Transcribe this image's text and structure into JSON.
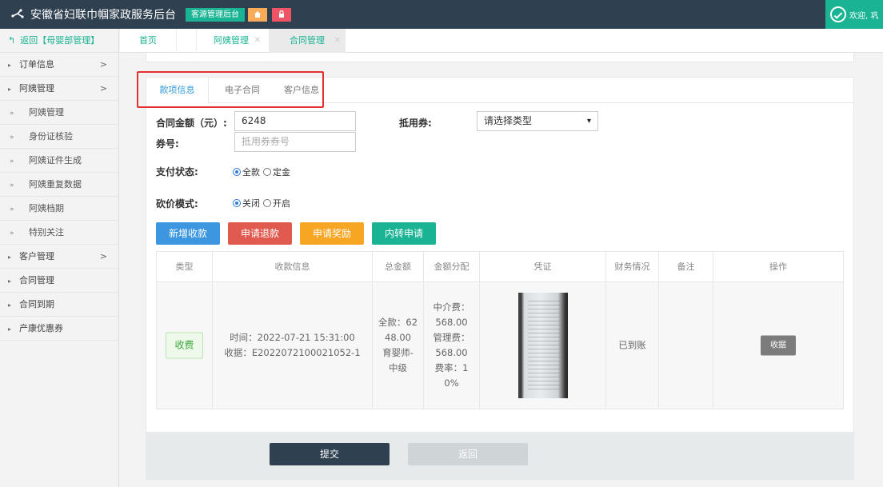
{
  "header": {
    "app_title": "安徽省妇联巾帼家政服务后台",
    "badge_source": "客源管理后台",
    "home_icon": "home-icon",
    "lock_icon": "lock-icon",
    "welcome": "欢迎, 巩"
  },
  "sidebar": {
    "back_label": "返回【母婴部管理】",
    "items": [
      {
        "label": "订单信息",
        "has_chevron": true
      },
      {
        "label": "阿姨管理",
        "has_chevron": true
      }
    ],
    "sub_items": [
      "阿姨管理",
      "身份证核验",
      "阿姨证件生成",
      "阿姨重复数据",
      "阿姨档期",
      "特别关注"
    ],
    "items_after": [
      {
        "label": "客户管理",
        "has_chevron": true
      },
      {
        "label": "合同管理",
        "has_chevron": false
      },
      {
        "label": "合同到期",
        "has_chevron": false
      },
      {
        "label": "产康优惠券",
        "has_chevron": false
      }
    ]
  },
  "nav_tabs": [
    {
      "label": "首页"
    },
    {
      "label": "阿姨管理"
    },
    {
      "label": "合同管理"
    }
  ],
  "panel": {
    "tabs": [
      "款项信息",
      "电子合同",
      "客户信息"
    ],
    "active_tab": "款项信息",
    "form": {
      "amount_label": "合同金额（元）:",
      "amount_value": "6248",
      "voucher_label": "抵用券:",
      "voucher_select": "请选择类型",
      "coupon_label": "券号:",
      "coupon_placeholder": "抵用券券号",
      "pay_status_label": "支付状态:",
      "pay_options": [
        "全款",
        "定金"
      ],
      "pay_selected": "全款",
      "bargain_label": "砍价模式:",
      "bargain_options": [
        "关闭",
        "开启"
      ],
      "bargain_selected": "关闭"
    },
    "buttons": {
      "add_payment": "新增收款",
      "apply_refund": "申请退款",
      "apply_reward": "申请奖励",
      "internal_transfer": "内转申请"
    },
    "table": {
      "headers": [
        "类型",
        "收款信息",
        "总金额",
        "金额分配",
        "凭证",
        "财务情况",
        "备注",
        "操作"
      ],
      "rows": [
        {
          "type": "收费",
          "info_time": "时间：2022-07-21 15:31:00",
          "info_receipt": "收据：E2022072100021052-1",
          "total_lines": [
            "全款：62",
            "48.00",
            "育婴师-",
            "中级"
          ],
          "alloc_lines": [
            "中介费：",
            "568.00",
            "管理费：",
            "568.00",
            "费率：1",
            "0%"
          ],
          "finance": "已到账",
          "remark": "",
          "action": "收据"
        }
      ]
    }
  },
  "footer_actions": {
    "submit": "提交",
    "back": "返回"
  },
  "colors": {
    "topbar": "#2f4050",
    "accent_green": "#1ab394",
    "accent_blue": "#3c96e0",
    "highlight_red": "#e03030"
  }
}
